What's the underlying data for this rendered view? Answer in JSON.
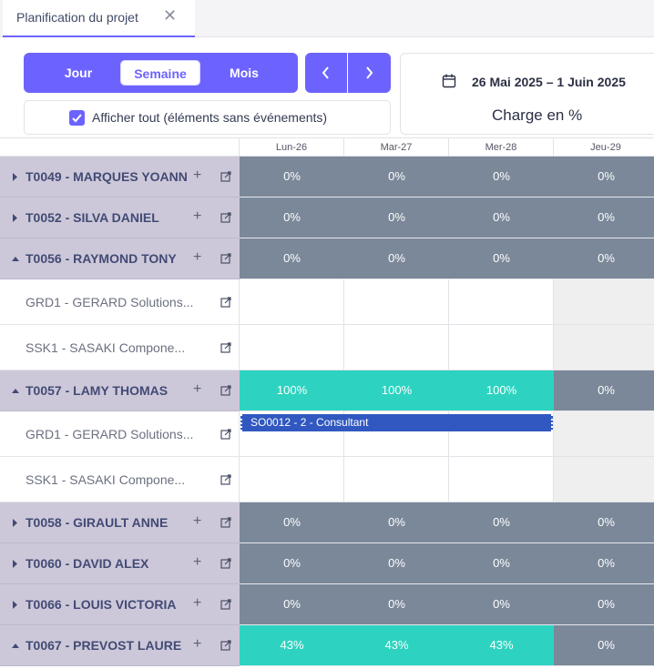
{
  "tab": {
    "title": "Planification du projet"
  },
  "toolbar": {
    "views": {
      "day": "Jour",
      "week": "Semaine",
      "month": "Mois"
    },
    "show_all_label": "Afficher tout (éléments sans événements)",
    "show_all_checked": true,
    "date_range": "26 Mai 2025 – 1 Juin 2025",
    "metric_label": "Charge en %"
  },
  "columns": [
    "Lun-26",
    "Mar-27",
    "Mer-28",
    "Jeu-29"
  ],
  "rows": [
    {
      "type": "parent",
      "name": "T0049 - MARQUES YOANN",
      "expanded": false,
      "cells": [
        "0%",
        "0%",
        "0%",
        "0%"
      ]
    },
    {
      "type": "parent",
      "name": "T0052 - SILVA DANIEL",
      "expanded": false,
      "cells": [
        "0%",
        "0%",
        "0%",
        "0%"
      ]
    },
    {
      "type": "parent",
      "name": "T0056 - RAYMOND TONY",
      "expanded": true,
      "cells": [
        "0%",
        "0%",
        "0%",
        "0%"
      ]
    },
    {
      "type": "child",
      "name": "GRD1 - GERARD Solutions..."
    },
    {
      "type": "child",
      "name": "SSK1 - SASAKI Compone..."
    },
    {
      "type": "parent",
      "name": "T0057 - LAMY THOMAS",
      "expanded": true,
      "cells": [
        "100%",
        "100%",
        "100%",
        "0%"
      ]
    },
    {
      "type": "child",
      "name": "GRD1 - GERARD Solutions...",
      "event": "SO0012 - 2 - Consultant"
    },
    {
      "type": "child",
      "name": "SSK1 - SASAKI Compone..."
    },
    {
      "type": "parent",
      "name": "T0058 - GIRAULT ANNE",
      "expanded": false,
      "cells": [
        "0%",
        "0%",
        "0%",
        "0%"
      ]
    },
    {
      "type": "parent",
      "name": "T0060 - DAVID ALEX",
      "expanded": false,
      "cells": [
        "0%",
        "0%",
        "0%",
        "0%"
      ]
    },
    {
      "type": "parent",
      "name": "T0066 - LOUIS VICTORIA",
      "expanded": false,
      "cells": [
        "0%",
        "0%",
        "0%",
        "0%"
      ]
    },
    {
      "type": "parent",
      "name": "T0067 - PREVOST LAURE",
      "expanded": true,
      "cells": [
        "43%",
        "43%",
        "43%",
        "0%"
      ]
    }
  ],
  "colors": {
    "accent": "#6c63ff",
    "load_zero": "#7a8899",
    "load_positive": "#2dd3c0",
    "event": "#3158c0",
    "parent_label_bg": "#cdc8d9"
  }
}
